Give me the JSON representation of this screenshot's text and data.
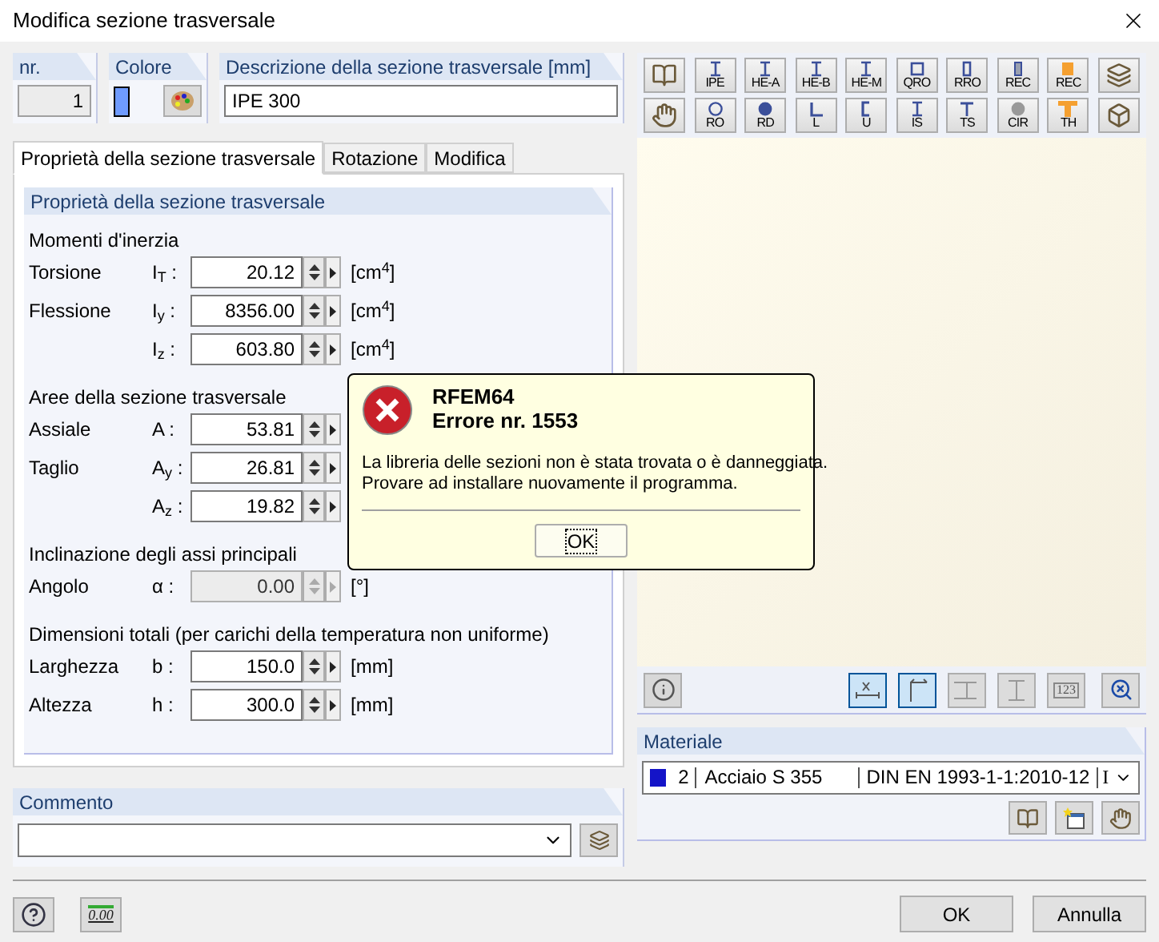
{
  "window": {
    "title": "Modifica sezione trasversale"
  },
  "header": {
    "number": {
      "label": "nr.",
      "value": "1"
    },
    "color": {
      "label": "Colore",
      "color": "#6f9bff"
    },
    "description": {
      "label": "Descrizione della sezione trasversale [mm]",
      "value": "IPE 300"
    }
  },
  "tabs": [
    {
      "label": "Proprietà della sezione trasversale",
      "selected": true
    },
    {
      "label": "Rotazione",
      "selected": false
    },
    {
      "label": "Modifica",
      "selected": false
    }
  ],
  "properties": {
    "title": "Proprietà della sezione trasversale",
    "groups": [
      {
        "title": "Momenti d'inerzia",
        "rows": [
          {
            "label": "Torsione",
            "symbol": "I$_{T}$ :",
            "value": "20.12",
            "unit": "[cm$^{4}$]",
            "disabled": false
          },
          {
            "label": "Flessione",
            "symbol": "I$_{y}$ :",
            "value": "8356.00",
            "unit": "[cm$^{4}$]",
            "disabled": false
          },
          {
            "symbol": "I$_{z}$ :",
            "value": "603.80",
            "unit": "[cm$^{4}$]",
            "disabled": false
          }
        ]
      },
      {
        "title": "Aree della sezione trasversale",
        "rows": [
          {
            "label": "Assiale",
            "symbol": "A :",
            "value": "53.81",
            "disabled": false
          },
          {
            "label": "Taglio",
            "symbol": "A$_{y}$ :",
            "value": "26.81",
            "disabled": false
          },
          {
            "symbol": "A$_{z}$ :",
            "value": "19.82",
            "disabled": false
          }
        ]
      },
      {
        "title": "Inclinazione degli assi principali",
        "rows": [
          {
            "label": "Angolo",
            "symbol": "α :",
            "value": "0.00",
            "unit": "[°]",
            "disabled": true
          }
        ]
      },
      {
        "title": "Dimensioni totali (per carichi della temperatura non uniforme)",
        "rows": [
          {
            "label": "Larghezza",
            "symbol": "b :",
            "value": "150.0",
            "unit": "[mm]",
            "disabled": false
          },
          {
            "label": "Altezza",
            "symbol": "h :",
            "value": "300.0",
            "unit": "[mm]",
            "disabled": false
          }
        ]
      }
    ]
  },
  "comment": {
    "label": "Commento"
  },
  "library_toolbar": [
    [
      {
        "kind": "book"
      },
      {
        "kind": "i-beam",
        "label": "IPE"
      },
      {
        "kind": "i-beam",
        "label": "HE-A"
      },
      {
        "kind": "i-beam",
        "label": "HE-B"
      },
      {
        "kind": "i-beam",
        "label": "HE-M"
      },
      {
        "kind": "square-tube",
        "label": "QRO"
      },
      {
        "kind": "narrow-tube",
        "label": "RRO"
      },
      {
        "kind": "bar-grey",
        "label": "REC"
      },
      {
        "kind": "bar-orange",
        "label": "REC"
      },
      {
        "kind": "profile-3d"
      }
    ],
    [
      {
        "kind": "hand"
      },
      {
        "kind": "ring",
        "label": "RO"
      },
      {
        "kind": "disc",
        "label": "RD"
      },
      {
        "kind": "angle",
        "label": "L"
      },
      {
        "kind": "channel",
        "label": "U"
      },
      {
        "kind": "i-beam",
        "label": "IS"
      },
      {
        "kind": "tee",
        "label": "TS"
      },
      {
        "kind": "disc-grey",
        "label": "CIR"
      },
      {
        "kind": "tee-orange",
        "label": "TH"
      },
      {
        "kind": "box-3d"
      }
    ]
  ],
  "preview_toolbar": [
    {
      "kind": "dimension",
      "selected": true
    },
    {
      "kind": "axes",
      "selected": true
    },
    {
      "kind": "frame",
      "selected": false
    },
    {
      "kind": "section",
      "selected": false
    },
    {
      "kind": "numbers",
      "label": "123",
      "selected": false
    }
  ],
  "material": {
    "label": "Materiale",
    "color": "#1414c8",
    "number": "2",
    "name": "Acciaio S 355",
    "standard": "DIN EN 1993-1-1:2010-12",
    "extra": "I"
  },
  "footer": {
    "value_icon": "0.00",
    "buttons": [
      "OK",
      "Annulla"
    ]
  },
  "error_dialog": {
    "title": "RFEM64",
    "subtitle": "Errore nr. 1553",
    "lines": [
      "La libreria delle sezioni non è stata trovata o è danneggiata.",
      "Provare ad installare nuovamente il programma."
    ],
    "button": "OK"
  }
}
